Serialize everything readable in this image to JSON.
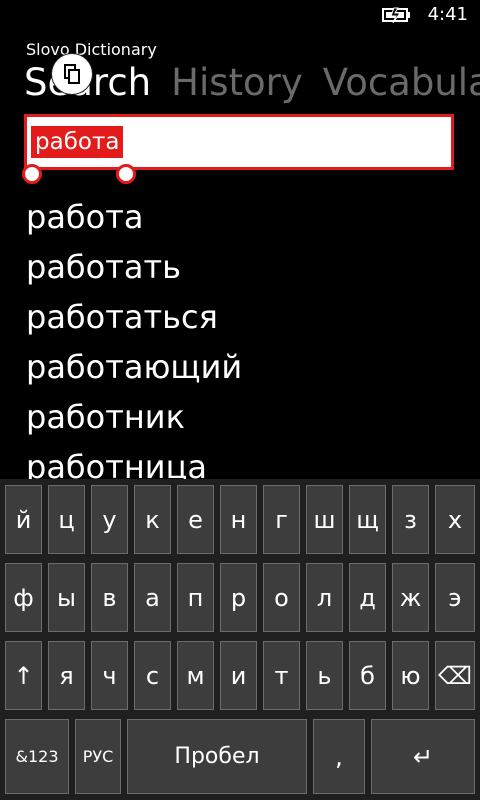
{
  "status": {
    "time": "4:41",
    "icons": [
      "battery-charging-icon"
    ]
  },
  "app": {
    "title": "Slovo Dictionary"
  },
  "pivot": {
    "tabs": [
      "Search",
      "History",
      "Vocabula"
    ],
    "active_index": 0
  },
  "search": {
    "value": "работа",
    "selection": "работа"
  },
  "results": [
    "работа",
    "работать",
    "работаться",
    "работающий",
    "работник",
    "работница"
  ],
  "keyboard": {
    "row1": [
      "й",
      "ц",
      "у",
      "к",
      "е",
      "н",
      "г",
      "ш",
      "щ",
      "з",
      "х"
    ],
    "row2": [
      "ф",
      "ы",
      "в",
      "а",
      "п",
      "р",
      "о",
      "л",
      "д",
      "ж",
      "э"
    ],
    "row3": [
      "↑",
      "я",
      "ч",
      "с",
      "м",
      "и",
      "т",
      "ь",
      "б",
      "ю",
      "⌫"
    ],
    "row4": {
      "symbols": "&123",
      "language": "РУС",
      "space": "Пробел",
      "comma": ",",
      "enter": "↵"
    }
  },
  "colors": {
    "accent": "#e31b1b",
    "background": "#000000",
    "key": "#3d3d3d",
    "key_border": "#6c6c6c",
    "inactive_tab": "#6a6a6a"
  }
}
